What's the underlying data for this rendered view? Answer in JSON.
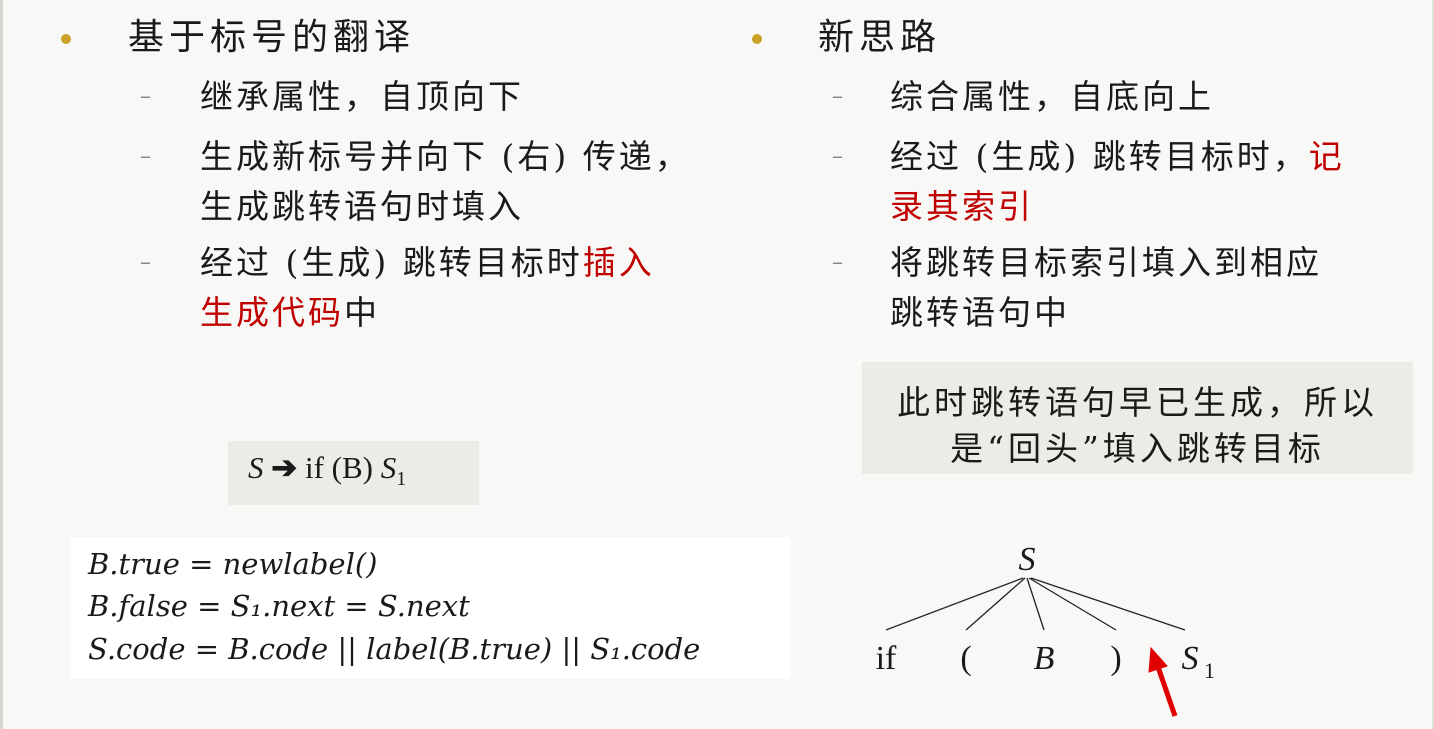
{
  "left": {
    "heading": "基于标号的翻译",
    "items": [
      {
        "lines": [
          [
            "继承属性，自顶向下",
            ""
          ]
        ]
      },
      {
        "lines": [
          [
            "生成新标号并向下 (右) 传递，",
            ""
          ],
          [
            "生成跳转语句时填入",
            ""
          ]
        ]
      },
      {
        "lines": [
          [
            "经过 (生成) 跳转目标时",
            "插入"
          ],
          [
            "",
            "生成代码"
          ]
        ],
        "tail": "中"
      }
    ],
    "dash": "–"
  },
  "right": {
    "heading": "新思路",
    "item1": "综合属性，自底向上",
    "item2_line1_plain": "经过 (生成) 跳转目标时，",
    "item2_line1_red": "记",
    "item2_line2_red": "录其索引",
    "item3_line1": "将跳转目标索引填入到相应",
    "item3_line2": "跳转语句中",
    "dash": "–"
  },
  "rule": {
    "lhs": "S",
    "arrow": "➔",
    "body": "if (B)",
    "rhs": "S",
    "rhs_sub": "1"
  },
  "code": {
    "line1": "B.true = newlabel()",
    "line2": "B.false = S₁.next = S.next",
    "line3": "S.code = B.code || label(B.true) || S₁.code"
  },
  "note": {
    "line1": "此时跳转语句早已生成，所以",
    "line2": "是“回头”填入跳转目标"
  },
  "tree": {
    "root": "S",
    "children": [
      "if",
      "(",
      "B",
      ")",
      "S"
    ],
    "last_sub": "1",
    "arrow_color": "#e00000"
  },
  "colors": {
    "bullet": "#c9a227",
    "emphasis": "#c00000"
  }
}
